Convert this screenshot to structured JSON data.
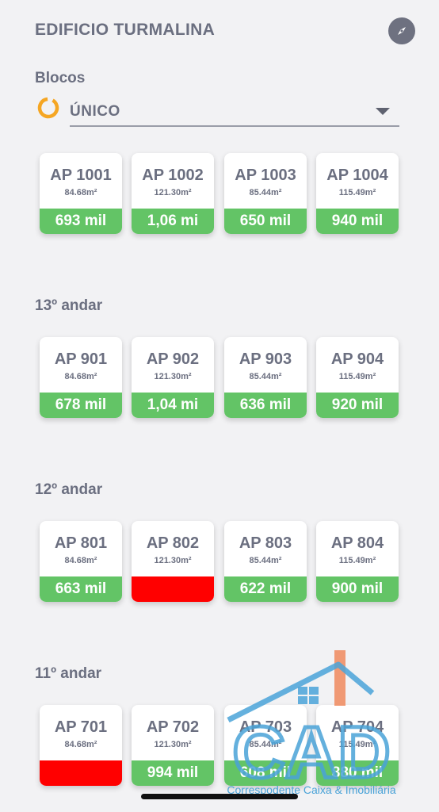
{
  "header": {
    "title": "EDIFICIO TURMALINA",
    "compass_icon": "compass-icon"
  },
  "blocks": {
    "label": "Blocos",
    "selected": "ÚNICO",
    "icon": "loading-ring-icon"
  },
  "colors": {
    "available": "#63c466",
    "sold": "#ff0000",
    "accent": "#f5a623",
    "text": "#6b6f80"
  },
  "floors": [
    {
      "label": "",
      "units": [
        {
          "name": "AP 1001",
          "area": "84.68m²",
          "price": "693 mil"
        },
        {
          "name": "AP 1002",
          "area": "121.30m²",
          "price": "1,06 mi"
        },
        {
          "name": "AP 1003",
          "area": "85.44m²",
          "price": "650 mil"
        },
        {
          "name": "AP 1004",
          "area": "115.49m²",
          "price": "940 mil"
        }
      ]
    },
    {
      "label": "13º andar",
      "units": [
        {
          "name": "AP 901",
          "area": "84.68m²",
          "price": "678 mil"
        },
        {
          "name": "AP 902",
          "area": "121.30m²",
          "price": "1,04 mi"
        },
        {
          "name": "AP 903",
          "area": "85.44m²",
          "price": "636 mil"
        },
        {
          "name": "AP 904",
          "area": "115.49m²",
          "price": "920 mil"
        }
      ]
    },
    {
      "label": "12º andar",
      "units": [
        {
          "name": "AP 801",
          "area": "84.68m²",
          "price": "663 mil"
        },
        {
          "name": "AP 802",
          "area": "121.30m²",
          "price": ""
        },
        {
          "name": "AP 803",
          "area": "85.44m²",
          "price": "622 mil"
        },
        {
          "name": "AP 804",
          "area": "115.49m²",
          "price": "900 mil"
        }
      ]
    },
    {
      "label": "11º andar",
      "units": [
        {
          "name": "AP 701",
          "area": "84.68m²",
          "price": ""
        },
        {
          "name": "AP 702",
          "area": "121.30m²",
          "price": "994 mil"
        },
        {
          "name": "AP 703",
          "area": "85.44m²",
          "price": "608 mil"
        },
        {
          "name": "AP 704",
          "area": "115.49m²",
          "price": "880 mil"
        }
      ]
    }
  ],
  "watermark": {
    "logo": "CAD",
    "text": "Correspodente Caixa & Imobiliária"
  }
}
